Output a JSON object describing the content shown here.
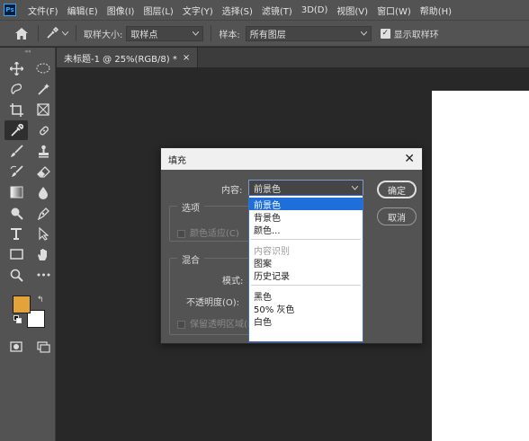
{
  "app": {
    "logo": "Ps"
  },
  "menu": [
    "文件(F)",
    "编辑(E)",
    "图像(I)",
    "图层(L)",
    "文字(Y)",
    "选择(S)",
    "滤镜(T)",
    "3D(D)",
    "视图(V)",
    "窗口(W)",
    "帮助(H)"
  ],
  "options": {
    "sample_size_label": "取样大小:",
    "sample_size_value": "取样点",
    "sample_label": "样本:",
    "sample_value": "所有图层",
    "show_ring_label": "显示取样环",
    "show_ring_checked": true
  },
  "document": {
    "tab_title": "未标题-1 @ 25%(RGB/8) *",
    "close_glyph": "×"
  },
  "colors": {
    "foreground": "#e4a23a",
    "background": "#ffffff"
  },
  "dialog": {
    "title": "填充",
    "close_glyph": "✕",
    "content_label": "内容:",
    "content_value": "前景色",
    "options_title": "选项",
    "color_adapt_label": "颜色适应(C)",
    "blend_title": "混合",
    "mode_label": "模式:",
    "opacity_label": "不透明度(O):",
    "preserve_label": "保留透明区域(P)",
    "ok_label": "确定",
    "cancel_label": "取消"
  },
  "dropdown": {
    "group1": [
      "前景色",
      "背景色",
      "颜色..."
    ],
    "group2": [
      "内容识别",
      "图案",
      "历史记录"
    ],
    "group3": [
      "黑色",
      "50% 灰色",
      "白色"
    ],
    "selected_index": 0
  }
}
